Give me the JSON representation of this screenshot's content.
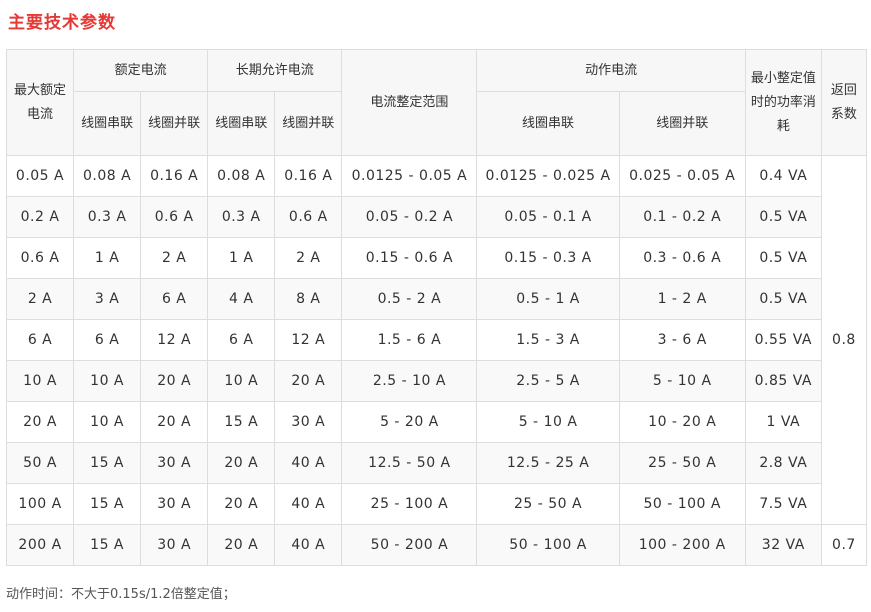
{
  "title": "主要技术参数",
  "headers": {
    "max_rated": "最大额定电流",
    "rated_current": "额定电流",
    "long_term": "长期允许电流",
    "range": "电流整定范围",
    "action_current": "动作电流",
    "min_power": "最小整定值时的功率消耗",
    "return_coef": "返回系数",
    "series": "线圈串联",
    "parallel": "线圈并联"
  },
  "rows": [
    [
      "0.05 A",
      "0.08 A",
      "0.16 A",
      "0.08 A",
      "0.16 A",
      "0.0125 - 0.05 A",
      "0.0125 - 0.025 A",
      "0.025 - 0.05 A",
      "0.4 VA"
    ],
    [
      "0.2 A",
      "0.3 A",
      "0.6 A",
      "0.3 A",
      "0.6 A",
      "0.05 - 0.2 A",
      "0.05 - 0.1 A",
      "0.1 - 0.2 A",
      "0.5 VA"
    ],
    [
      "0.6 A",
      "1 A",
      "2 A",
      "1 A",
      "2 A",
      "0.15 - 0.6 A",
      "0.15 - 0.3 A",
      "0.3 - 0.6 A",
      "0.5 VA"
    ],
    [
      "2 A",
      "3 A",
      "6 A",
      "4 A",
      "8 A",
      "0.5 - 2 A",
      "0.5 - 1 A",
      "1 - 2 A",
      "0.5 VA"
    ],
    [
      "6 A",
      "6 A",
      "12 A",
      "6 A",
      "12 A",
      "1.5 - 6 A",
      "1.5 - 3 A",
      "3 - 6 A",
      "0.55 VA"
    ],
    [
      "10 A",
      "10 A",
      "20 A",
      "10 A",
      "20 A",
      "2.5 - 10 A",
      "2.5 - 5 A",
      "5 - 10 A",
      "0.85 VA"
    ],
    [
      "20 A",
      "10 A",
      "20 A",
      "15 A",
      "30 A",
      "5 - 20 A",
      "5 - 10 A",
      "10 - 20 A",
      "1 VA"
    ],
    [
      "50 A",
      "15 A",
      "30 A",
      "20 A",
      "40 A",
      "12.5 - 50 A",
      "12.5 - 25 A",
      "25 - 50 A",
      "2.8 VA"
    ],
    [
      "100 A",
      "15 A",
      "30 A",
      "20 A",
      "40 A",
      "25 - 100 A",
      "25 - 50 A",
      "50 - 100 A",
      "7.5 VA"
    ],
    [
      "200 A",
      "15 A",
      "30 A",
      "20 A",
      "40 A",
      "50 - 200 A",
      "50 - 100 A",
      "100 - 200 A",
      "32 VA"
    ]
  ],
  "return_values": [
    "0.8",
    "0.7"
  ],
  "footnote": "动作时间：不大于0.15s/1.2倍整定值；"
}
